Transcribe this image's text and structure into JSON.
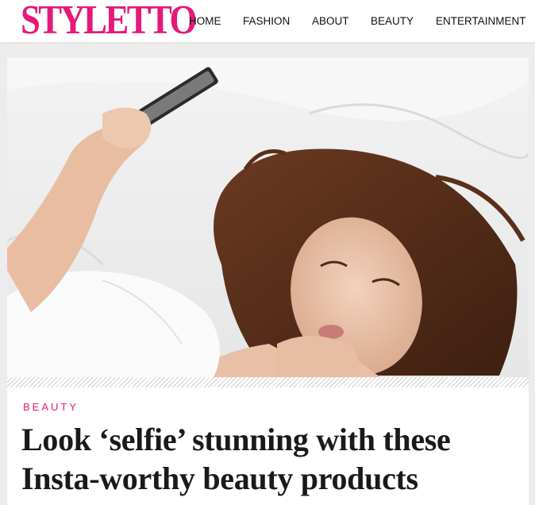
{
  "header": {
    "logo": "STYLETTO",
    "brand_color": "#e5197a",
    "nav": [
      {
        "label": "HOME"
      },
      {
        "label": "FASHION"
      },
      {
        "label": "ABOUT"
      },
      {
        "label": "BEAUTY"
      },
      {
        "label": "ENTERTAINMENT"
      }
    ]
  },
  "article": {
    "hero_image": "woman lying on white bed taking a selfie",
    "category": "BEAUTY",
    "headline": "Look ‘selfie’ stunning with these Insta-worthy beauty products"
  }
}
